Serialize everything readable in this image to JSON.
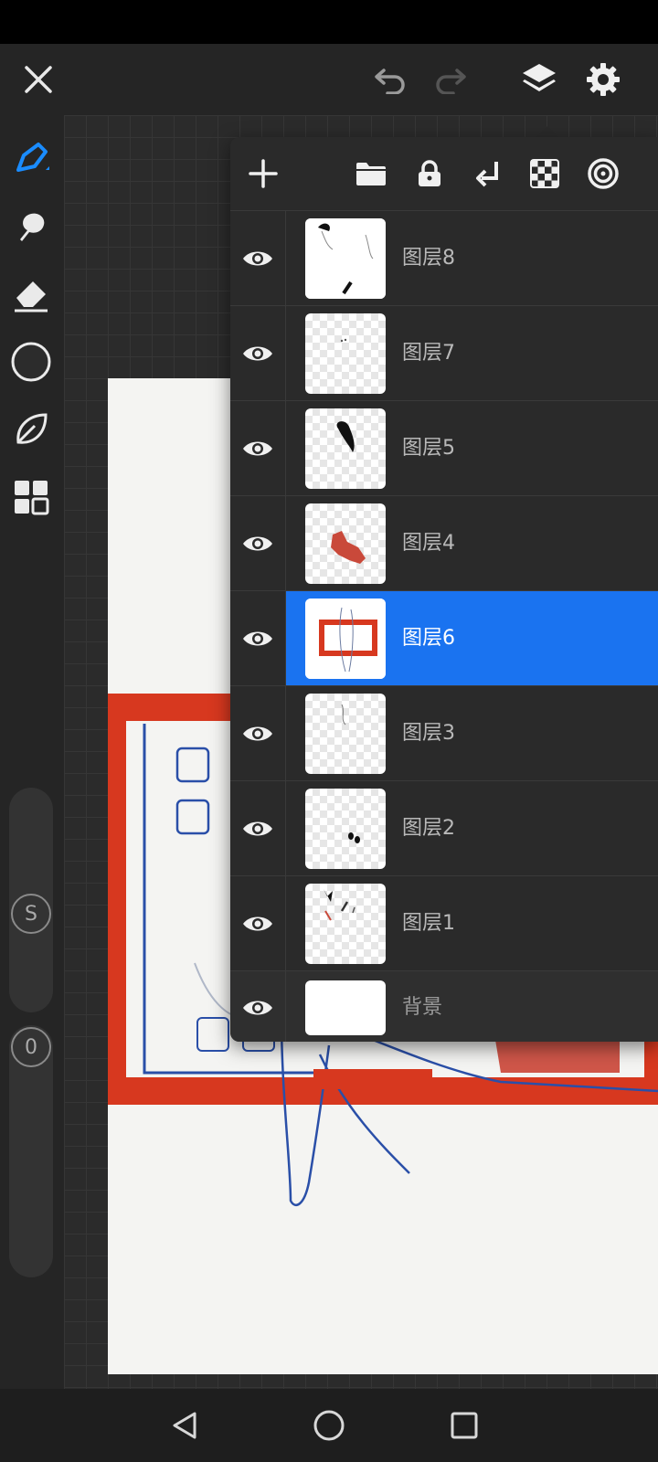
{
  "topbar": {
    "close_icon": "close-icon",
    "undo_icon": "undo-icon",
    "redo_icon": "redo-icon",
    "layers_icon": "layers-icon",
    "settings_icon": "gear-icon"
  },
  "tools": [
    "brush-icon",
    "smudge-icon",
    "eraser-icon",
    "color-swatch",
    "leaf-icon",
    "grid-icon"
  ],
  "sliders": {
    "size_label": "S",
    "opacity_label": "0"
  },
  "layers_panel": {
    "tools": [
      "add-layer-icon",
      "folder-icon",
      "lock-icon",
      "merge-down-icon",
      "checker-icon",
      "target-icon"
    ],
    "layers": [
      {
        "name": "图层8",
        "selected": false
      },
      {
        "name": "图层7",
        "selected": false
      },
      {
        "name": "图层5",
        "selected": false
      },
      {
        "name": "图层4",
        "selected": false
      },
      {
        "name": "图层6",
        "selected": true
      },
      {
        "name": "图层3",
        "selected": false
      },
      {
        "name": "图层2",
        "selected": false
      },
      {
        "name": "图层1",
        "selected": false
      }
    ],
    "background": {
      "name": "背景"
    }
  },
  "colors": {
    "accent": "#1a73f0",
    "paint_red": "#d7381f",
    "sketch_blue": "#2a4fa8"
  },
  "navbar": [
    "back-icon",
    "home-icon",
    "recents-icon"
  ]
}
